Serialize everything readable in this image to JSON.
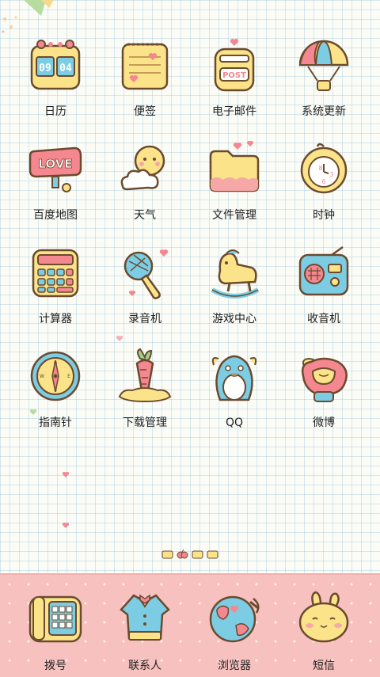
{
  "home_grid": {
    "apps": [
      {
        "label": "日历",
        "icon": "calendar-icon",
        "calendar_hour": "09",
        "calendar_minute": "04"
      },
      {
        "label": "便签",
        "icon": "notepad-icon"
      },
      {
        "label": "电子邮件",
        "icon": "mailbox-icon",
        "mail_text": "POST"
      },
      {
        "label": "系统更新",
        "icon": "hot-air-balloon-icon"
      },
      {
        "label": "百度地图",
        "icon": "love-sign-map-icon",
        "love_text": "LOVE"
      },
      {
        "label": "天气",
        "icon": "sun-cloud-icon"
      },
      {
        "label": "文件管理",
        "icon": "folder-icon"
      },
      {
        "label": "时钟",
        "icon": "clock-icon"
      },
      {
        "label": "计算器",
        "icon": "calculator-icon"
      },
      {
        "label": "录音机",
        "icon": "microphone-icon"
      },
      {
        "label": "游戏中心",
        "icon": "rocking-horse-icon"
      },
      {
        "label": "收音机",
        "icon": "radio-icon"
      },
      {
        "label": "指南针",
        "icon": "compass-icon"
      },
      {
        "label": "下载管理",
        "icon": "carrot-icon"
      },
      {
        "label": "QQ",
        "icon": "penguin-icon"
      },
      {
        "label": "微博",
        "icon": "bow-glove-icon"
      }
    ]
  },
  "page_indicator": {
    "pages": 4,
    "current": 2
  },
  "dock": {
    "apps": [
      {
        "label": "拨号",
        "icon": "telephone-icon"
      },
      {
        "label": "联系人",
        "icon": "contacts-jacket-icon"
      },
      {
        "label": "浏览器",
        "icon": "globe-icon"
      },
      {
        "label": "短信",
        "icon": "bunny-icon"
      }
    ]
  },
  "colors": {
    "background": "#fbfcf6",
    "grid_line": "#96bed7",
    "dock": "#f7c1bf",
    "icon_yellow": "#fbe38a",
    "icon_pink": "#f4878f",
    "icon_blue": "#7ccde4",
    "outline": "#6b4a2e"
  }
}
